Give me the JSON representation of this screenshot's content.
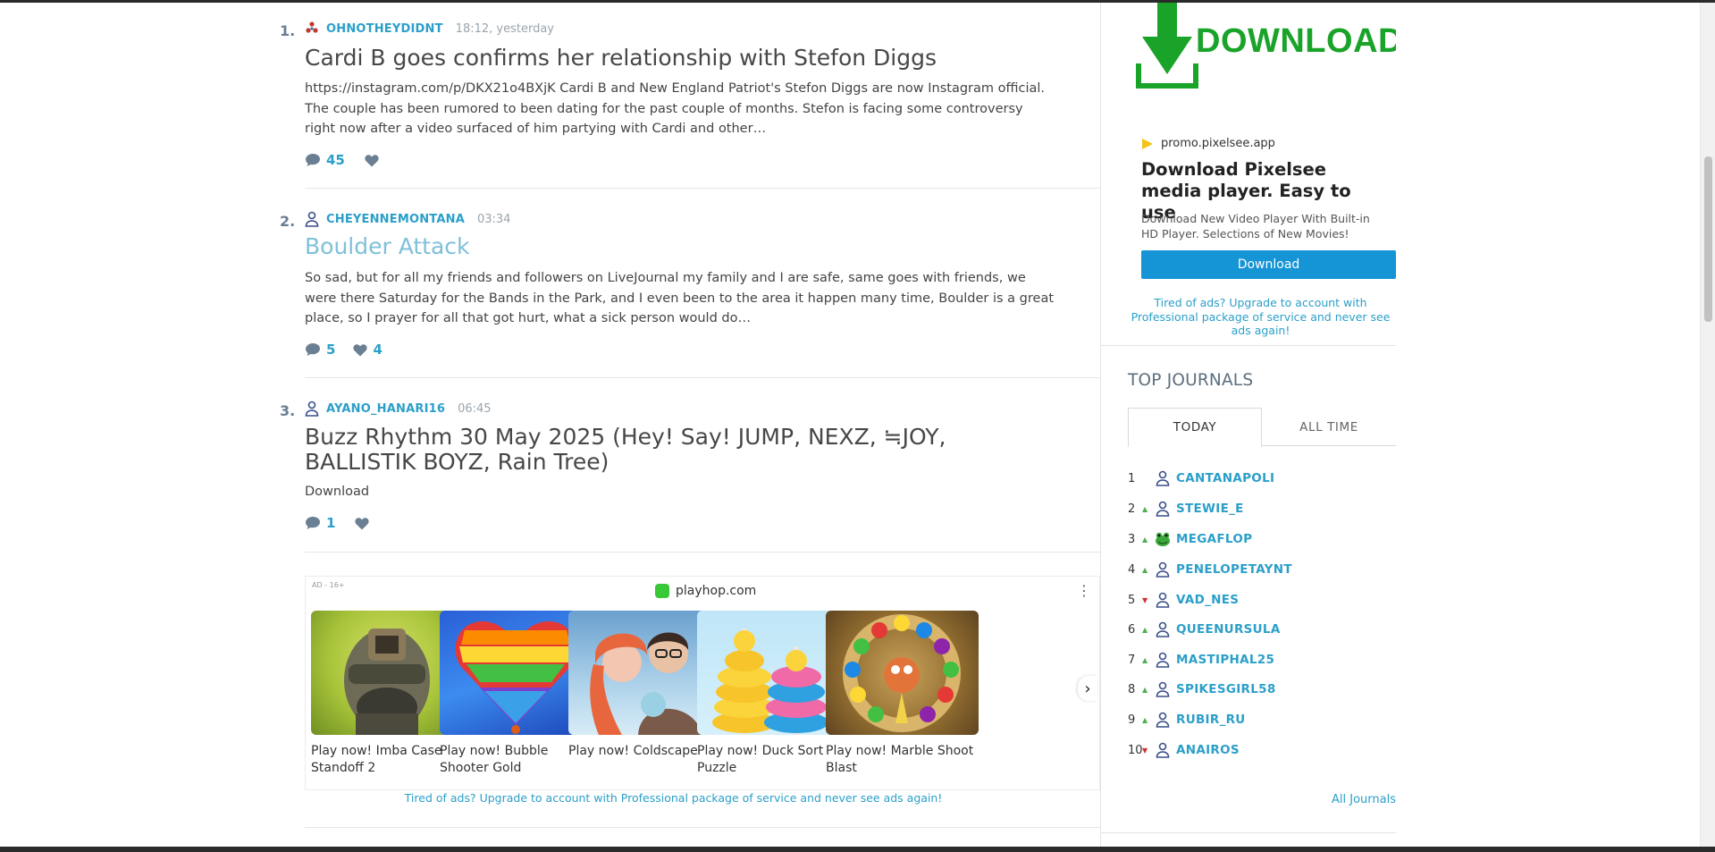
{
  "posts": [
    {
      "rank": "1.",
      "username": "OHNOTHEYDIDNT",
      "time": "18:12, yesterday",
      "title": "Cardi B goes confirms her relationship with Stefon Diggs",
      "excerpt": "https://instagram.com/p/DKX21o4BXjK Cardi B and New England Patriot's Stefon Diggs are now Instagram official. The couple has been rumored to been dating for the past couple of months. Stefon is facing some controversy right now after a video surfaced of him partying with Cardi and other…",
      "comments": "45",
      "likes": ""
    },
    {
      "rank": "2.",
      "username": "CHEYENNEMONTANA",
      "time": "03:34",
      "title": "Boulder Attack",
      "excerpt": "So sad, but for all my friends and followers on LiveJournal my family and I are safe, same goes with friends, we were there Saturday for the Bands in the Park, and I even been to the area it happen many time, Boulder is a great place, so I prayer for all that got hurt, what a sick person would do…",
      "comments": "5",
      "likes": "4"
    },
    {
      "rank": "3.",
      "username": "AYANO_HANARI16",
      "time": "06:45",
      "title": "Buzz Rhythm 30 May 2025 (Hey! Say! JUMP, NEXZ, ≒JOY, BALLISTIK BOYZ, Rain Tree)",
      "excerpt": "Download",
      "comments": "1",
      "likes": ""
    }
  ],
  "ad": {
    "label": "AD - 16+",
    "domain": "playhop.com",
    "games": [
      {
        "caption": "Play now! Imba Case Standoff 2"
      },
      {
        "caption": "Play now! Bubble Shooter Gold"
      },
      {
        "caption": "Play now! Coldscape"
      },
      {
        "caption": "Play now! Duck Sort Puzzle"
      },
      {
        "caption": "Play now! Marble Shoot Blast"
      }
    ],
    "upgrade_text": "Tired of ads? Upgrade to account with Professional package of service and never see ads again!"
  },
  "sidebar_ad": {
    "banner_text": "DOWNLOAD",
    "source": "promo.pixelsee.app",
    "title": "Download Pixelsee media player. Easy to use",
    "description": "Download New Video Player With Built-in HD Player. Selections of New Movies!",
    "button": "Download",
    "upgrade_text": "Tired of ads? Upgrade to account with Professional package of service and never see ads again!"
  },
  "top_journals": {
    "title": "TOP JOURNALS",
    "tabs": [
      "TODAY",
      "ALL TIME"
    ],
    "active_tab": "TODAY",
    "items": [
      {
        "rank": "1",
        "trend": "",
        "name": "CANTANAPOLI"
      },
      {
        "rank": "2",
        "trend": "up",
        "name": "STEWIE_E"
      },
      {
        "rank": "3",
        "trend": "up",
        "name": "MEGAFLOP"
      },
      {
        "rank": "4",
        "trend": "up",
        "name": "PENELOPETAYNT"
      },
      {
        "rank": "5",
        "trend": "down",
        "name": "VAD_NES"
      },
      {
        "rank": "6",
        "trend": "up",
        "name": "QUEENURSULA"
      },
      {
        "rank": "7",
        "trend": "up",
        "name": "MASTIPHAL25"
      },
      {
        "rank": "8",
        "trend": "up",
        "name": "SPIKESGIRL58"
      },
      {
        "rank": "9",
        "trend": "up",
        "name": "RUBIR_RU"
      },
      {
        "rank": "10",
        "trend": "down",
        "name": "ANAIROS"
      }
    ],
    "all_link": "All Journals"
  },
  "colors": {
    "link": "#2b9fc9",
    "title_visited": "#7fc0d9",
    "ad_button": "#1594d6",
    "banner_green": "#1aa329",
    "trend_up": "#4caf50",
    "trend_down": "#d32f2f"
  }
}
